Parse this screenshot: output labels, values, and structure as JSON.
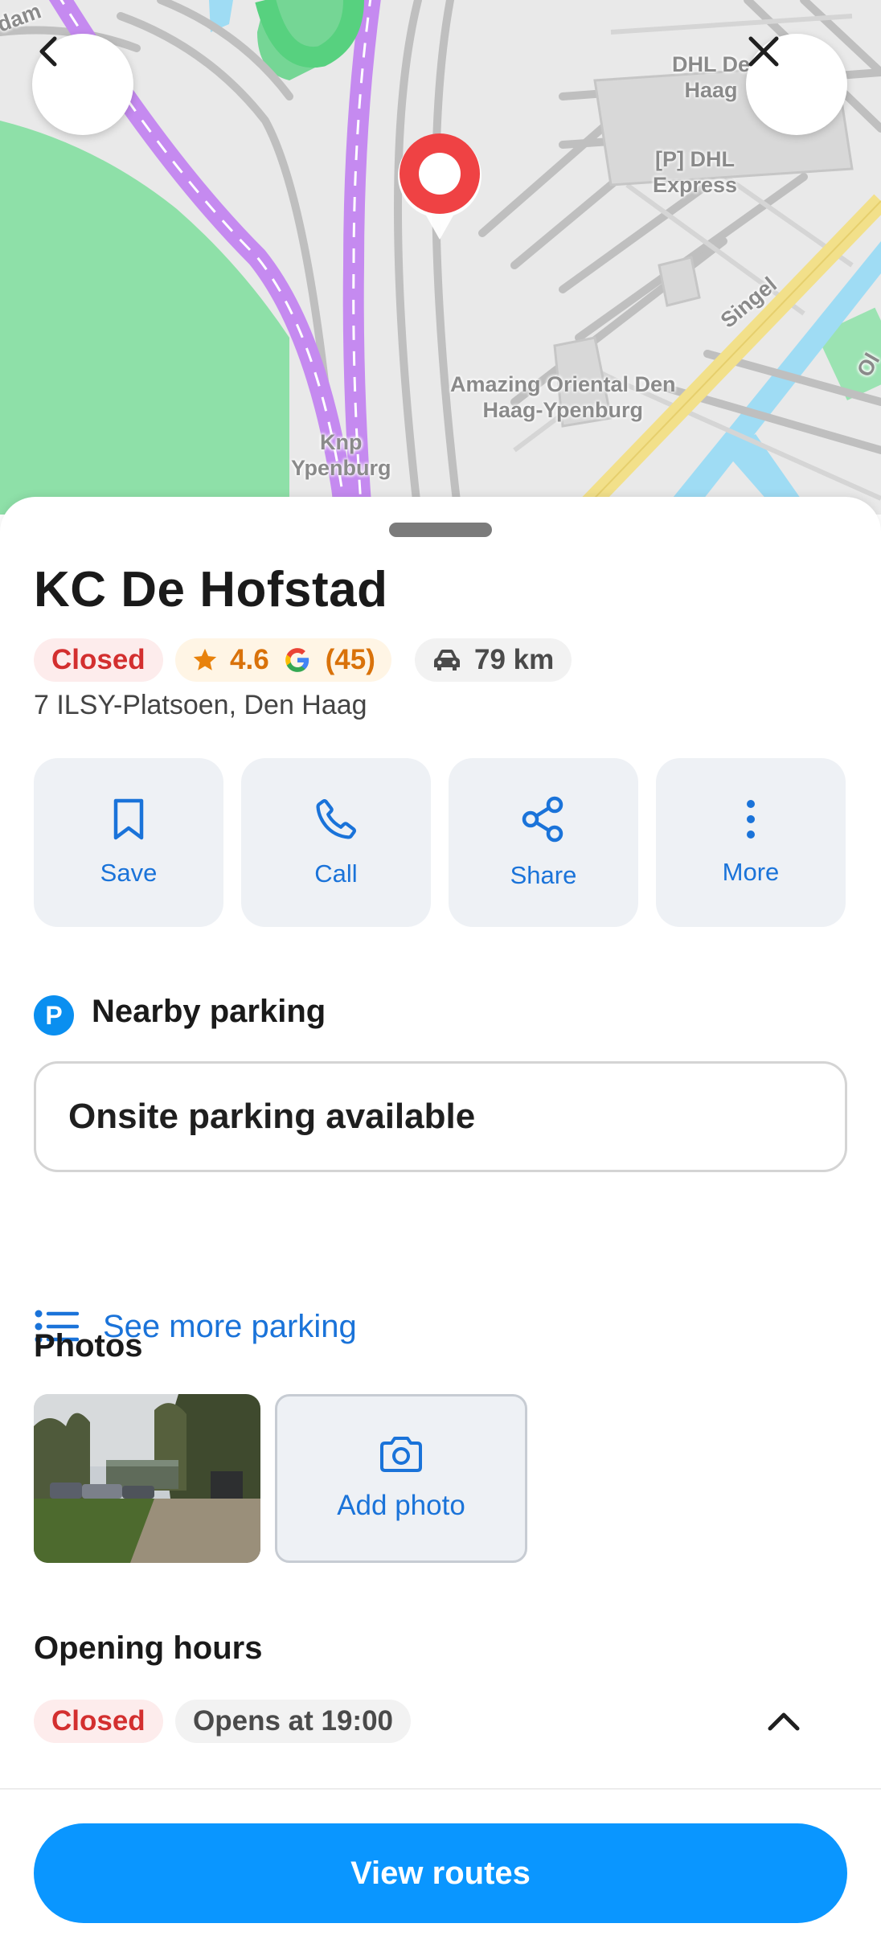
{
  "map": {
    "labels": {
      "dhl_den_haag": "DHL De\nHaag",
      "dhl_express": "[P] DHL\nExpress",
      "singel": "Singel",
      "amazing_oriental": "Amazing Oriental Den\nHaag-Ypenburg",
      "knp_ypenburg": "Knp\nYpenburg",
      "partial_top_left": "dam",
      "partial_right": "Ol"
    },
    "pin_color": "#ef4244",
    "colors": {
      "highway": "#c58af0",
      "park": "#8ee0a8",
      "water": "#9fdcf4",
      "main_road": "#f2e08a"
    }
  },
  "header": {
    "back_icon": "chevron-left-icon",
    "close_icon": "close-icon"
  },
  "place": {
    "name": "KC De Hofstad",
    "status": "Closed",
    "rating": "4.6",
    "review_count": "(45)",
    "distance": "79 km",
    "address": "7 ILSY-Platsoen, Den Haag"
  },
  "actions": [
    {
      "label": "Save",
      "icon": "bookmark-icon"
    },
    {
      "label": "Call",
      "icon": "phone-icon"
    },
    {
      "label": "Share",
      "icon": "share-icon"
    },
    {
      "label": "More",
      "icon": "more-vertical-icon"
    }
  ],
  "parking": {
    "badge": "P",
    "heading": "Nearby parking",
    "onsite": "Onsite parking available",
    "see_more": "See more parking"
  },
  "photos": {
    "heading": "Photos",
    "add_label": "Add photo"
  },
  "hours": {
    "heading": "Opening hours",
    "status": "Closed",
    "opens": "Opens at 19:00"
  },
  "footer": {
    "view_routes": "View routes"
  },
  "accent": "#1a73d9",
  "primary_button": "#0a96ff",
  "closed_color": "#d32f2f",
  "rating_color": "#d9720a"
}
